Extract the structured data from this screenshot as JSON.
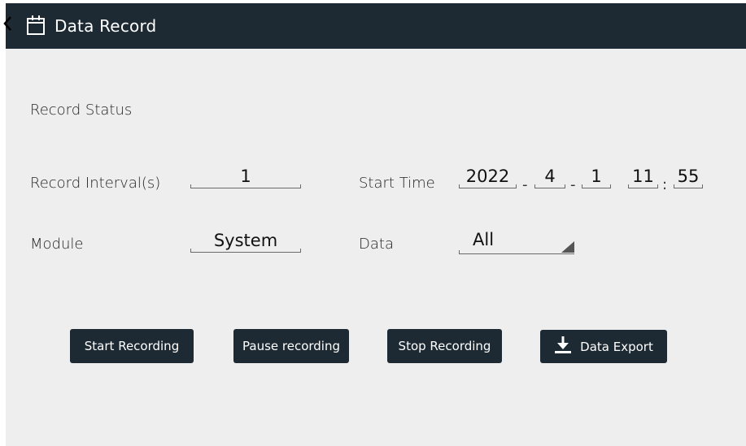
{
  "header": {
    "title": "Data Record",
    "back_icon": "chevron-left-icon",
    "calendar_icon": "calendar-icon"
  },
  "form": {
    "record_status_label": "Record Status",
    "record_interval_label": "Record Interval(s)",
    "record_interval_value": "1",
    "start_time_label": "Start Time",
    "start_time": {
      "year": "2022",
      "month": "4",
      "day": "1",
      "hour": "11",
      "minute": "55",
      "date_sep": "-",
      "time_sep": ":"
    },
    "module_label": "Module",
    "module_value": "System",
    "data_label": "Data",
    "data_value": "All"
  },
  "buttons": {
    "start": "Start Recording",
    "pause": "Pause recording",
    "stop": "Stop Recording",
    "export": "Data Export",
    "export_icon": "download-icon"
  },
  "colors": {
    "header_bg": "#1d2a33",
    "button_bg": "#1d2a33",
    "panel_bg": "#eeeeee"
  }
}
